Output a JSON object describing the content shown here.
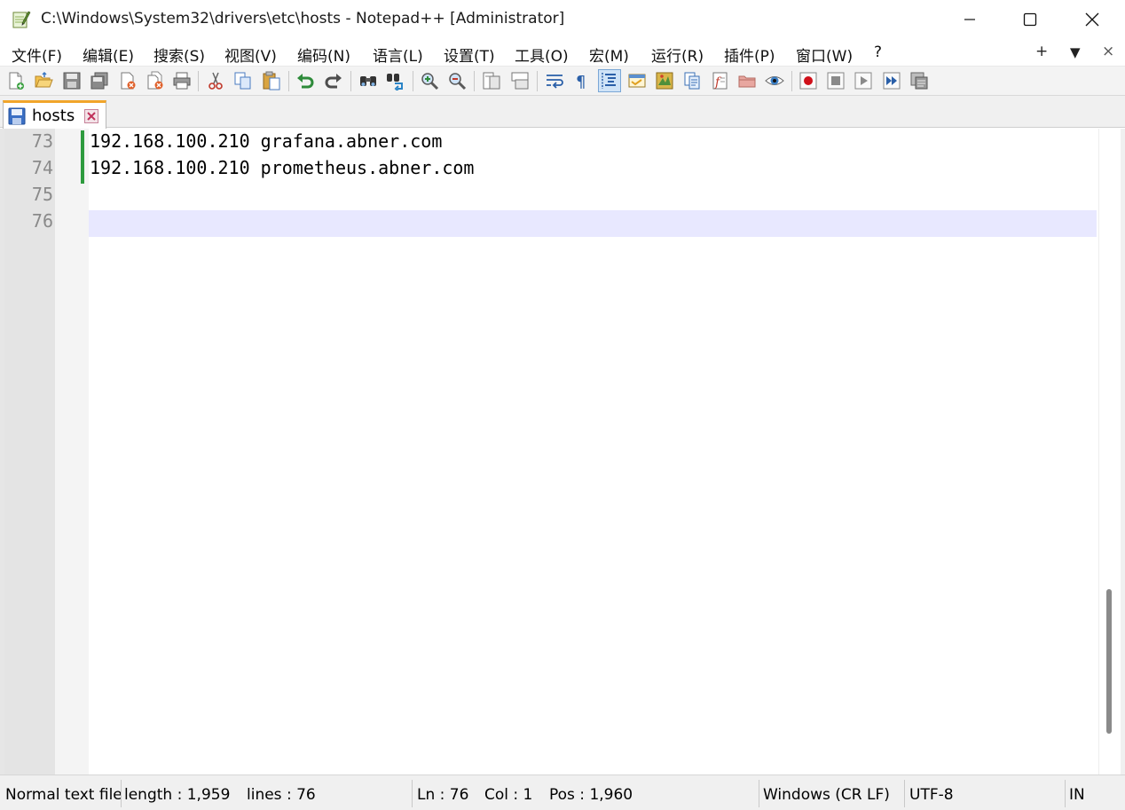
{
  "window": {
    "title": "C:\\Windows\\System32\\drivers\\etc\\hosts - Notepad++ [Administrator]",
    "controls": {
      "minimize": "minimize",
      "maximize": "maximize",
      "close": "close"
    }
  },
  "menu": {
    "items": [
      "文件(F)",
      "编辑(E)",
      "搜索(S)",
      "视图(V)",
      "编码(N)",
      "语言(L)",
      "设置(T)",
      "工具(O)",
      "宏(M)",
      "运行(R)",
      "插件(P)",
      "窗口(W)",
      "?"
    ],
    "right": {
      "plus": "+",
      "dropdown": "▼",
      "close": "×"
    }
  },
  "toolbar": {
    "icons": [
      "new-file-icon",
      "open-file-icon",
      "save-icon",
      "save-all-icon",
      "close-icon",
      "close-all-icon",
      "print-icon",
      "cut-icon",
      "copy-icon",
      "paste-icon",
      "undo-icon",
      "redo-icon",
      "find-icon",
      "replace-icon",
      "zoom-in-icon",
      "zoom-out-icon",
      "sync-vertical-icon",
      "sync-horizontal-icon",
      "word-wrap-icon",
      "show-all-chars-icon",
      "indent-guide-icon",
      "udl-icon",
      "doc-map-icon",
      "doc-list-icon",
      "function-list-icon",
      "folder-workspace-icon",
      "monitoring-icon",
      "record-macro-icon",
      "stop-macro-icon",
      "play-macro-icon",
      "run-macro-multiple-icon",
      "save-macro-icon"
    ],
    "active": "indent-guide-icon"
  },
  "tabs": [
    {
      "label": "hosts",
      "icon": "save-icon",
      "active": true
    }
  ],
  "editor": {
    "lines": [
      {
        "number": "73",
        "text": "192.168.100.210 grafana.abner.com",
        "modified": true
      },
      {
        "number": "74",
        "text": "192.168.100.210 prometheus.abner.com",
        "modified": true
      },
      {
        "number": "75",
        "text": "",
        "modified": false
      },
      {
        "number": "76",
        "text": "",
        "modified": false
      }
    ],
    "current_line": "76",
    "current_line_color": "#e8e8ff",
    "change_marker_color": "#2e9b3e"
  },
  "statusbar": {
    "file_type": "Normal text file",
    "length": "length : 1,959",
    "lines": "lines : 76",
    "ln": "Ln : 76",
    "col": "Col : 1",
    "pos": "Pos : 1,960",
    "eol": "Windows (CR LF)",
    "encoding": "UTF-8",
    "mode": "IN"
  }
}
